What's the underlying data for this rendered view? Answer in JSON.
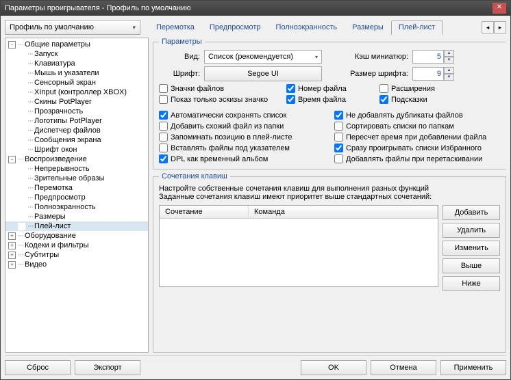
{
  "window": {
    "title": "Параметры проигрывателя - Профиль по умолчанию"
  },
  "profile": {
    "selected": "Профиль по умолчанию"
  },
  "tabs": [
    "Перемотка",
    "Предпросмотр",
    "Полноэкранность",
    "Размеры",
    "Плей-лист"
  ],
  "tree": {
    "root1": "Общие параметры",
    "root1_items": [
      "Запуск",
      "Клавиатура",
      "Мышь и указатели",
      "Сенсорный экран",
      "XInput (контроллер XBOX)",
      "Скины PotPlayer",
      "Прозрачность",
      "Логотипы PotPlayer",
      "Диспетчер файлов",
      "Сообщения экрана",
      "Шрифт окон"
    ],
    "root2": "Воспроизведение",
    "root2_items": [
      "Непрерывность",
      "Зрительные образы",
      "Перемотка",
      "Предпросмотр",
      "Полноэкранность",
      "Размеры",
      "Плей-лист"
    ],
    "extras": [
      "Оборудование",
      "Кодеки и фильтры",
      "Субтитры",
      "Видео"
    ]
  },
  "params": {
    "legend": "Параметры",
    "vid_label": "Вид:",
    "vid_value": "Список (рекомендуется)",
    "font_label": "Шрифт:",
    "font_value": "Segoe UI",
    "thumb_label": "Кэш миниатюр:",
    "thumb_value": "5",
    "fsize_label": "Размер шрифта:",
    "fsize_value": "9",
    "checks1": [
      "Значки файлов",
      "Номер файла",
      "Расширения",
      "Показ только эскизы значко",
      "Время файла",
      "Подсказки"
    ],
    "checks1_state": [
      false,
      true,
      false,
      false,
      true,
      true
    ],
    "checks2": [
      "Автоматически сохранять список",
      "Не добавлять дубликаты файлов",
      "Добавить схожий файл из папки",
      "Сортировать списки по папкам",
      "Запоминать позицию в плей-листе",
      "Пересчет время при добавлении файла",
      "Вставлять файлы под указателем",
      "Сразу проигрывать списки Избранного",
      "DPL как временный альбом",
      "Добавлять файлы при перетаскивании"
    ],
    "checks2_state": [
      true,
      true,
      false,
      false,
      false,
      false,
      false,
      true,
      true,
      false
    ]
  },
  "shortcuts": {
    "legend": "Сочетания клавиш",
    "hint1": "Настройте собственные сочетания клавиш для выполнения разных функций",
    "hint2": "Заданные сочетания клавиш имеют приоритет выше стандартных сочетаний:",
    "col1": "Сочетание",
    "col2": "Команда",
    "btns": [
      "Добавить",
      "Удалить",
      "Изменить",
      "Выше",
      "Ниже"
    ]
  },
  "footer": {
    "reset": "Сброс",
    "export": "Экспорт",
    "ok": "OK",
    "cancel": "Отмена",
    "apply": "Применить"
  }
}
